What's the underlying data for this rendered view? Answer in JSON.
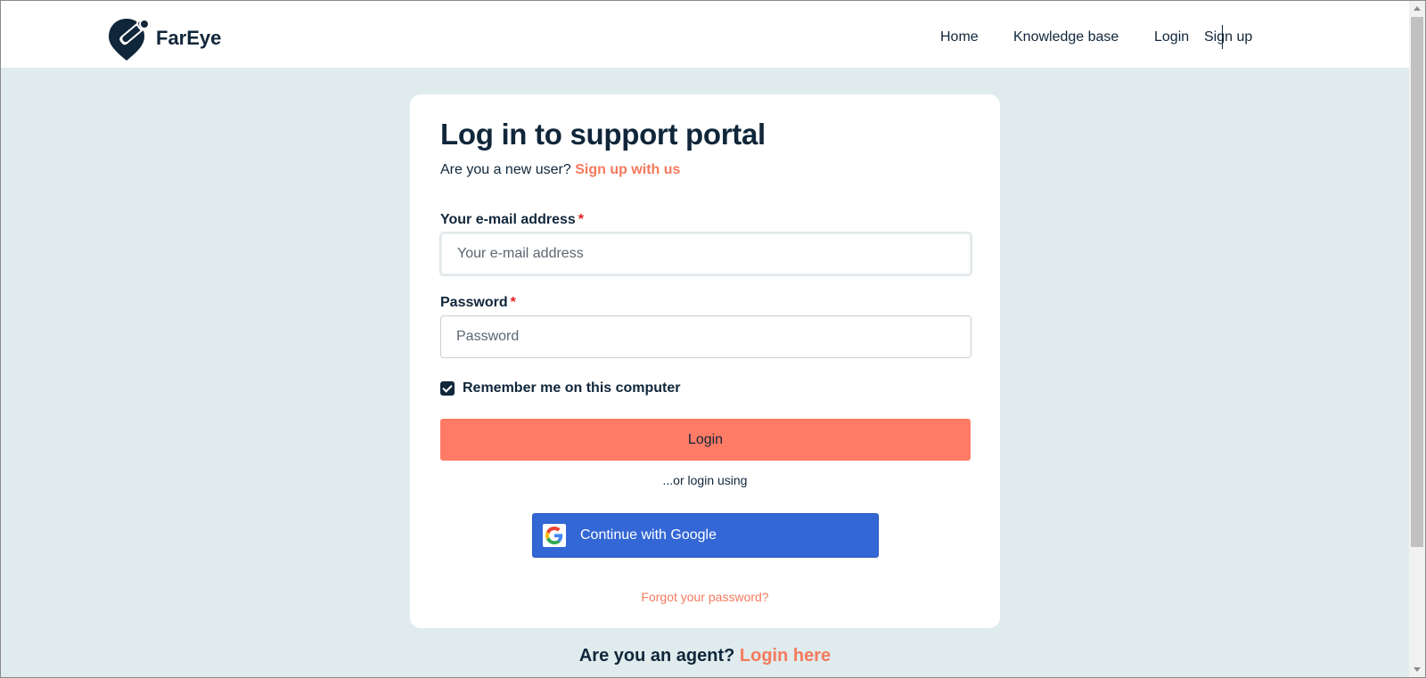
{
  "brand": {
    "name": "FarEye",
    "logo": "fareye-logo-icon"
  },
  "nav": {
    "home": "Home",
    "knowledge_base": "Knowledge base",
    "login": "Login",
    "signup": "Sign up"
  },
  "card": {
    "title": "Log in to support portal",
    "new_user_prompt": "Are you a new user?",
    "signup_link": "Sign up with us",
    "email_label": "Your e-mail address",
    "email_placeholder": "Your e-mail address",
    "email_value": "",
    "password_label": "Password",
    "password_placeholder": "Password",
    "password_value": "",
    "required_mark": "*",
    "remember_label": "Remember me on this computer",
    "remember_checked": true,
    "login_button": "Login",
    "or_text": "...or login using",
    "google_button": "Continue with Google",
    "google_icon": "google-g-icon",
    "forgot_link": "Forgot your password?"
  },
  "footer": {
    "agent_prompt": "Are you an agent?",
    "agent_link": "Login here"
  },
  "colors": {
    "accent": "#ff7b65",
    "link": "#f47a5d",
    "navy": "#10263a",
    "background": "#e0ebed",
    "google_blue": "#3367d6"
  }
}
